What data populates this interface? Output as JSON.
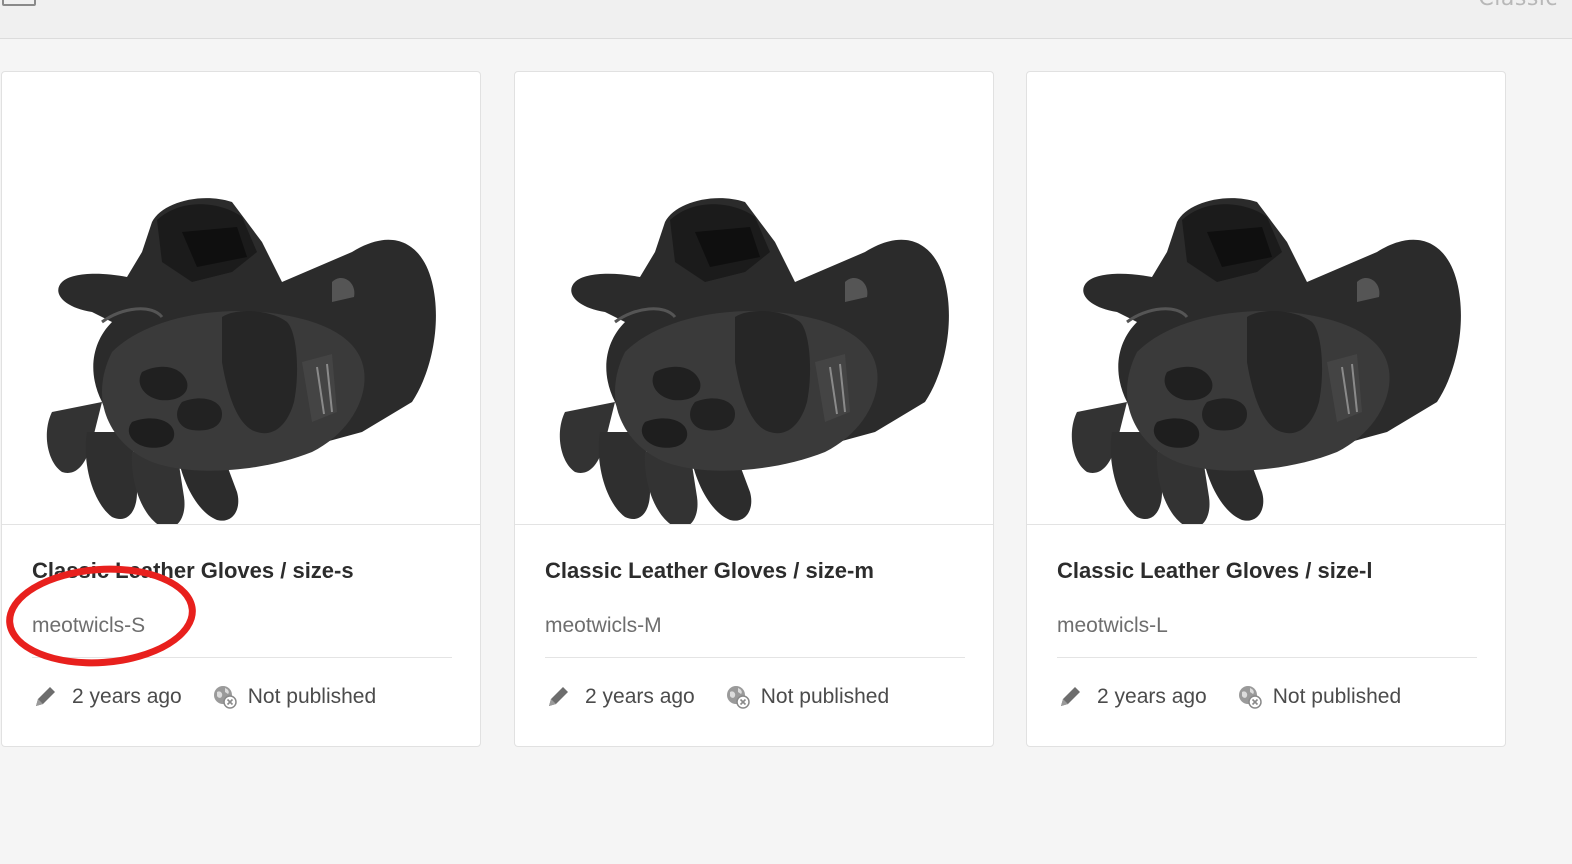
{
  "header": {
    "title": "Classic"
  },
  "colors": {
    "annotation": "#e8201d",
    "background": "#f5f5f5",
    "card": "#ffffff"
  },
  "cards": [
    {
      "title": "Classic Leather Gloves / size-s",
      "sku": "meotwicls-S",
      "modified": "2 years ago",
      "status": "Not published",
      "image": "leather-gloves-image",
      "highlighted": true
    },
    {
      "title": "Classic Leather Gloves / size-m",
      "sku": "meotwicls-M",
      "modified": "2 years ago",
      "status": "Not published",
      "image": "leather-gloves-image",
      "highlighted": false
    },
    {
      "title": "Classic Leather Gloves / size-l",
      "sku": "meotwicls-L",
      "modified": "2 years ago",
      "status": "Not published",
      "image": "leather-gloves-image",
      "highlighted": false
    }
  ]
}
